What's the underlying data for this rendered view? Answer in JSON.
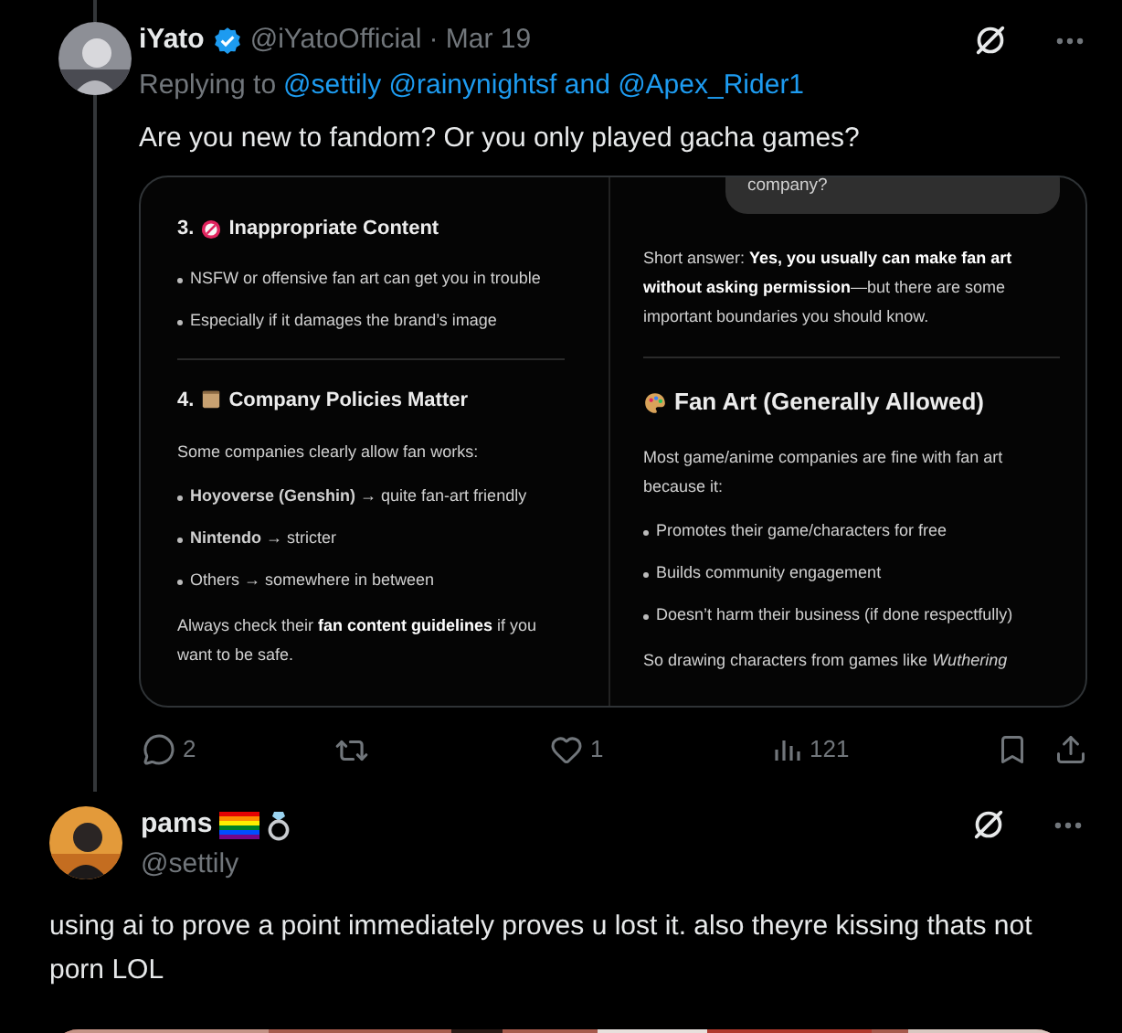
{
  "tweet": {
    "name": "iYato",
    "verified": true,
    "handle": "@iYatoOfficial",
    "date": "· Mar 19",
    "replying_label": "Replying to",
    "replying_to": "@settily @rainynightsf and @Apex_Rider1",
    "text": "Are you new to fandom? Or you only played gacha games?",
    "screenshot": {
      "left": [
        {
          "kind": "heading",
          "number": "3.",
          "title": "Inappropriate Content"
        },
        {
          "kind": "bullet",
          "text": "NSFW or offensive fan art can get you in trouble"
        },
        {
          "kind": "bullet",
          "text": "Especially if it damages the brand’s image"
        },
        {
          "kind": "rule"
        },
        {
          "kind": "heading",
          "number": "4.",
          "title": "Company Policies Matter"
        },
        {
          "kind": "para",
          "text": "Some companies clearly allow fan works:"
        },
        {
          "kind": "bullet",
          "text": "**Hoyoverse (Genshin)** → quite fan-art friendly"
        },
        {
          "kind": "bullet",
          "text": "**Nintendo** → stricter"
        },
        {
          "kind": "bullet",
          "text": "Others → somewhere in between"
        },
        {
          "kind": "para",
          "text": "Always check their **fan content guidelines** if you want to be safe."
        }
      ],
      "right": [
        {
          "kind": "bubble",
          "text": "company?"
        },
        {
          "kind": "para",
          "text": "Short answer: **Yes, you usually can make fan art without asking permission**—but there are some important boundaries you should know."
        },
        {
          "kind": "rule"
        },
        {
          "kind": "heading",
          "title": "Fan Art (Generally Allowed)"
        },
        {
          "kind": "para",
          "text": "Most game/anime companies are fine with fan art because it:"
        },
        {
          "kind": "bullet",
          "text": "Promotes their game/characters for free"
        },
        {
          "kind": "bullet",
          "text": "Builds community engagement"
        },
        {
          "kind": "bullet",
          "text": "Doesn’t harm their business (if done respectfully)"
        },
        {
          "kind": "para",
          "text": "So drawing characters from games like *Wuthering*"
        }
      ]
    },
    "actions": {
      "replies": "2",
      "likes": "1",
      "views": "121"
    }
  },
  "reply": {
    "name": "pams",
    "handle": "@settily",
    "text": "using ai to prove a point immediately proves u lost it. also theyre kissing thats not porn LOL"
  }
}
